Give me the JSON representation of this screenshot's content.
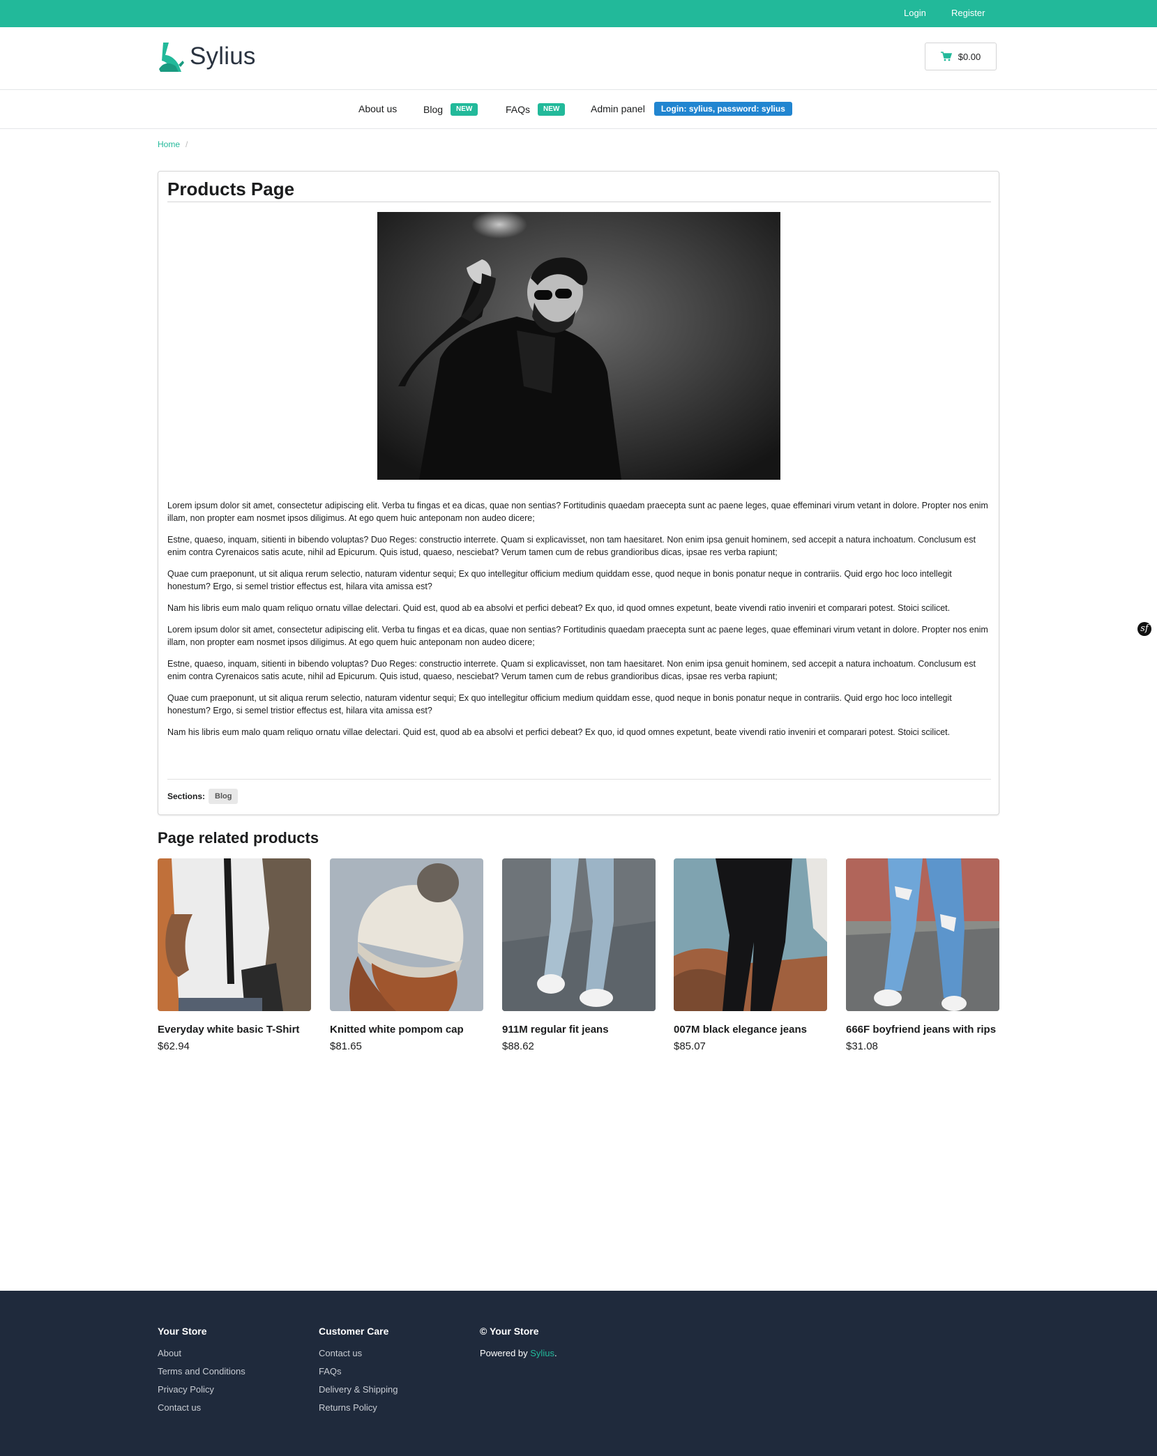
{
  "topbar": {
    "login": "Login",
    "register": "Register"
  },
  "header": {
    "logo_text": "Sylius",
    "cart_total": "$0.00"
  },
  "nav": {
    "about": "About us",
    "blog": "Blog",
    "blog_badge": "NEW",
    "faqs": "FAQs",
    "faqs_badge": "NEW",
    "admin": "Admin panel",
    "admin_badge": "Login: sylius, password: sylius"
  },
  "breadcrumb": {
    "home": "Home",
    "divider": "/"
  },
  "page": {
    "title": "Products Page",
    "paragraphs": [
      "Lorem ipsum dolor sit amet, consectetur adipiscing elit. Verba tu fingas et ea dicas, quae non sentias? Fortitudinis quaedam praecepta sunt ac paene leges, quae effeminari virum vetant in dolore. Propter nos enim illam, non propter eam nosmet ipsos diligimus. At ego quem huic anteponam non audeo dicere;",
      "Estne, quaeso, inquam, sitienti in bibendo voluptas? Duo Reges: constructio interrete. Quam si explicavisset, non tam haesitaret. Non enim ipsa genuit hominem, sed accepit a natura inchoatum. Conclusum est enim contra Cyrenaicos satis acute, nihil ad Epicurum. Quis istud, quaeso, nesciebat? Verum tamen cum de rebus grandioribus dicas, ipsae res verba rapiunt;",
      "Quae cum praeponunt, ut sit aliqua rerum selectio, naturam videntur sequi; Ex quo intellegitur officium medium quiddam esse, quod neque in bonis ponatur neque in contrariis. Quid ergo hoc loco intellegit honestum? Ergo, si semel tristior effectus est, hilara vita amissa est?",
      "Nam his libris eum malo quam reliquo ornatu villae delectari. Quid est, quod ab ea absolvi et perfici debeat? Ex quo, id quod omnes expetunt, beate vivendi ratio inveniri et comparari potest. Stoici scilicet.",
      "Lorem ipsum dolor sit amet, consectetur adipiscing elit. Verba tu fingas et ea dicas, quae non sentias? Fortitudinis quaedam praecepta sunt ac paene leges, quae effeminari virum vetant in dolore. Propter nos enim illam, non propter eam nosmet ipsos diligimus. At ego quem huic anteponam non audeo dicere;",
      "Estne, quaeso, inquam, sitienti in bibendo voluptas? Duo Reges: constructio interrete. Quam si explicavisset, non tam haesitaret. Non enim ipsa genuit hominem, sed accepit a natura inchoatum. Conclusum est enim contra Cyrenaicos satis acute, nihil ad Epicurum. Quis istud, quaeso, nesciebat? Verum tamen cum de rebus grandioribus dicas, ipsae res verba rapiunt;",
      "Quae cum praeponunt, ut sit aliqua rerum selectio, naturam videntur sequi; Ex quo intellegitur officium medium quiddam esse, quod neque in bonis ponatur neque in contrariis. Quid ergo hoc loco intellegit honestum? Ergo, si semel tristior effectus est, hilara vita amissa est?",
      "Nam his libris eum malo quam reliquo ornatu villae delectari. Quid est, quod ab ea absolvi et perfici debeat? Ex quo, id quod omnes expetunt, beate vivendi ratio inveniri et comparari potest. Stoici scilicet."
    ],
    "sections_label": "Sections:",
    "sections_tag": "Blog"
  },
  "related": {
    "title": "Page related products",
    "products": [
      {
        "name": "Everyday white basic T-Shirt",
        "price": "$62.94"
      },
      {
        "name": "Knitted white pompom cap",
        "price": "$81.65"
      },
      {
        "name": "911M regular fit jeans",
        "price": "$88.62"
      },
      {
        "name": "007M black elegance jeans",
        "price": "$85.07"
      },
      {
        "name": "666F boyfriend jeans with rips",
        "price": "$31.08"
      }
    ]
  },
  "footer": {
    "col1": {
      "title": "Your Store",
      "links": [
        "About",
        "Terms and Conditions",
        "Privacy Policy",
        "Contact us"
      ]
    },
    "col2": {
      "title": "Customer Care",
      "links": [
        "Contact us",
        "FAQs",
        "Delivery & Shipping",
        "Returns Policy"
      ]
    },
    "col3": {
      "title": "© Your Store",
      "powered_prefix": "Powered by ",
      "powered_link": "Sylius",
      "powered_suffix": "."
    }
  },
  "colors": {
    "brand": "#22b99a",
    "admin_badge": "#2185d0",
    "footer_bg": "#1f2a3c"
  },
  "icons": [
    "cart-icon",
    "sylius-logo",
    "symfony-icon"
  ]
}
